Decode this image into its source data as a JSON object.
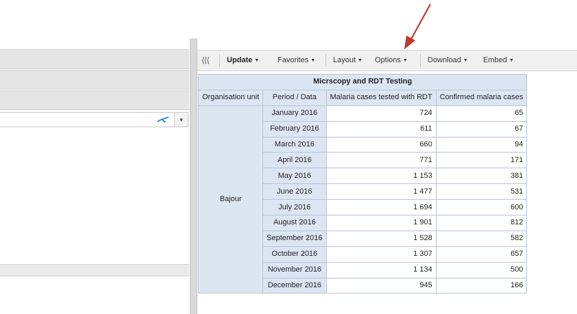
{
  "toolbar": {
    "collapse_icon": "double-chevron-left-icon",
    "update_label": "Update",
    "favorites_label": "Favorites",
    "layout_label": "Layout",
    "options_label": "Options",
    "download_label": "Download",
    "embed_label": "Embed"
  },
  "table": {
    "title": "Micrscopy and RDT Testing",
    "headers": {
      "org": "Organisation unit",
      "period": "Period / Data",
      "tested": "Malaria cases tested with RDT",
      "confirmed": "Confirmed malaria cases"
    },
    "org_unit": "Bajour",
    "rows": [
      {
        "period": "January 2016",
        "tested": "724",
        "confirmed": "65"
      },
      {
        "period": "February 2016",
        "tested": "611",
        "confirmed": "67"
      },
      {
        "period": "March 2016",
        "tested": "660",
        "confirmed": "94"
      },
      {
        "period": "April 2016",
        "tested": "771",
        "confirmed": "171"
      },
      {
        "period": "May 2016",
        "tested": "1 153",
        "confirmed": "381"
      },
      {
        "period": "June 2016",
        "tested": "1 477",
        "confirmed": "531"
      },
      {
        "period": "July 2016",
        "tested": "1 694",
        "confirmed": "600"
      },
      {
        "period": "August 2016",
        "tested": "1 901",
        "confirmed": "812"
      },
      {
        "period": "September 2016",
        "tested": "1 528",
        "confirmed": "582"
      },
      {
        "period": "October 2016",
        "tested": "1 307",
        "confirmed": "657"
      },
      {
        "period": "November 2016",
        "tested": "1 134",
        "confirmed": "500"
      },
      {
        "period": "December 2016",
        "tested": "945",
        "confirmed": "166"
      }
    ]
  },
  "colors": {
    "header_bg": "#dce6f2",
    "grid_border": "#b7c4d6",
    "annotation_arrow": "#c0392b"
  }
}
